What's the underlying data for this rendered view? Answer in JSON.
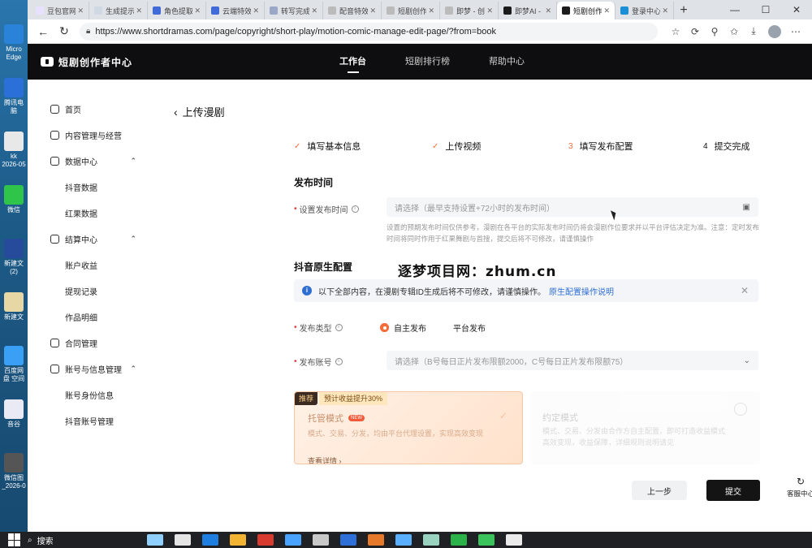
{
  "desktop": {
    "icons": [
      {
        "label": "Micro Edge",
        "color": "#2b82d9"
      },
      {
        "label": "腾讯电脑",
        "color": "#2b6fd8"
      },
      {
        "label": "kk 2026-05",
        "color": "#e8e8e8"
      },
      {
        "label": "微信",
        "color": "#2ec54a"
      },
      {
        "label": "新建文 (2)",
        "color": "#274b9b"
      },
      {
        "label": "新建文",
        "color": "#e7d7a5"
      },
      {
        "label": "百度网盘 空间",
        "color": "#3aa0f5"
      },
      {
        "label": "音谷",
        "color": "#eaeaf5"
      },
      {
        "label": "微信图 _2026-0",
        "color": "#555"
      }
    ]
  },
  "browser": {
    "tabs": [
      {
        "label": "豆包官网",
        "color": "#e8e0ff",
        "active": false
      },
      {
        "label": "生成提示",
        "color": "#cfd8e3",
        "active": false
      },
      {
        "label": "角色提取",
        "color": "#3f6ad8",
        "active": false
      },
      {
        "label": "云端特效",
        "color": "#3f6ad8",
        "active": false
      },
      {
        "label": "转写完成",
        "color": "#9aa7c7",
        "active": false
      },
      {
        "label": "配音特效",
        "color": "#bbbbbb",
        "active": false
      },
      {
        "label": "短剧创作",
        "color": "#bbbbbb",
        "active": false
      },
      {
        "label": "即梦 - 创",
        "color": "#bbbbbb",
        "active": false
      },
      {
        "label": "即梦AI -",
        "color": "#1b1b1b",
        "active": false
      },
      {
        "label": "短剧创作",
        "color": "#1b1b1b",
        "active": true
      },
      {
        "label": "登录中心",
        "color": "#1a8fd6",
        "active": false
      }
    ],
    "url": "https://www.shortdramas.com/page/copyright/short-play/motion-comic-manage-edit-page/?from=book"
  },
  "site": {
    "logo_text": "短剧创作者中心",
    "nav": [
      {
        "label": "工作台",
        "active": true
      },
      {
        "label": "短剧排行榜",
        "active": false
      },
      {
        "label": "帮助中心",
        "active": false
      }
    ]
  },
  "sidebar": {
    "items": [
      {
        "label": "首页",
        "type": "top"
      },
      {
        "label": "内容管理与经营",
        "type": "top"
      },
      {
        "label": "数据中心",
        "type": "group",
        "chev": "^"
      },
      {
        "label": "抖音数据",
        "type": "sub"
      },
      {
        "label": "红果数据",
        "type": "sub"
      },
      {
        "label": "结算中心",
        "type": "group",
        "chev": "^"
      },
      {
        "label": "账户收益",
        "type": "sub"
      },
      {
        "label": "提现记录",
        "type": "sub"
      },
      {
        "label": "作品明细",
        "type": "sub"
      },
      {
        "label": "合同管理",
        "type": "top"
      },
      {
        "label": "账号与信息管理",
        "type": "group",
        "chev": "^"
      },
      {
        "label": "账号身份信息",
        "type": "sub"
      },
      {
        "label": "抖音账号管理",
        "type": "sub"
      }
    ]
  },
  "page": {
    "back_label": "上传漫剧",
    "steps": [
      {
        "num": "✓",
        "label": "填写基本信息",
        "state": "done"
      },
      {
        "num": "✓",
        "label": "上传视频",
        "state": "done"
      },
      {
        "num": "3",
        "label": "填写发布配置",
        "state": "current"
      },
      {
        "num": "4",
        "label": "提交完成",
        "state": "todo"
      }
    ],
    "publish_time": {
      "section": "发布时间",
      "label": "设置发布时间",
      "placeholder": "请选择（最早支持设置+72小时的发布时间）",
      "hint_line1": "设置的预期发布时间仅供参考，漫剧在各平台的实际发布时间仍将会漫剧作位要求并以平台评估决定为准。注意：定时发布",
      "hint_line2": "时间将同时作用于红果舞剧与首搜，提交后将不可修改，请谨慎操作"
    },
    "douyin": {
      "section": "抖音原生配置",
      "notice": "以下全部内容，在漫剧专辑ID生成后将不可修改，请谨慎操作。",
      "notice_link": "原生配置操作说明",
      "publish_type_label": "发布类型",
      "publish_type_options": [
        "自主发布",
        "平台发布"
      ],
      "account_label": "发布账号",
      "account_placeholder": "请选择（B号每日正片发布限额2000，C号每日正片发布限额75）"
    },
    "cards": {
      "recommend_badge": "推荐",
      "boost_badge": "预计收益提升30%",
      "managed_title": "托管模式",
      "new_badge": "NEW",
      "managed_desc": "模式、交易、分发，均由平台代理设置，实现高效变现",
      "managed_more": "查看详情 ›",
      "agreed_title": "约定模式",
      "agreed_desc": "模式、交易、分发由合作方自主配置，即可打造收益模式高效变现，收益保障，详细规则说明请见"
    },
    "buttons": {
      "prev": "上一步",
      "submit": "提交",
      "service": "客服中心"
    }
  },
  "watermark": "逐梦项目网：zhum.cn",
  "taskbar": {
    "search": "搜索",
    "apps": [
      "#8fd0ff",
      "#e4e4e4",
      "#1f7fe0",
      "#f3b434",
      "#d73a2f",
      "#4aa3ff",
      "#c8c8c8",
      "#2f6fd8",
      "#e67a2a",
      "#5ab0ff",
      "#9ad2c0",
      "#2bb34a",
      "#3ac35a",
      "#eaeaea"
    ]
  }
}
